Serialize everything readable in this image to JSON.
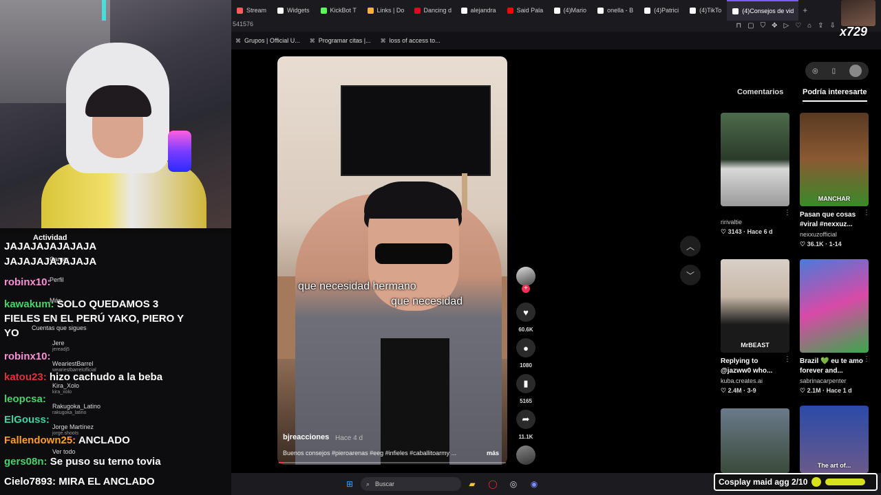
{
  "browser": {
    "tabs": [
      {
        "label": "Stream",
        "color": "#ff5b5b"
      },
      {
        "label": "Widgets",
        "color": "#ffffff"
      },
      {
        "label": "KickBot T",
        "color": "#5bff5b"
      },
      {
        "label": "Links | Do",
        "color": "#ffb13b"
      },
      {
        "label": "Dancing d",
        "color": "#e60023"
      },
      {
        "label": "alejandra",
        "color": "#ffffff"
      },
      {
        "label": "Said Pala",
        "color": "#ff0000"
      },
      {
        "label": "(4)Mario",
        "color": "#ffffff"
      },
      {
        "label": "onella - B",
        "color": "#ffffff"
      },
      {
        "label": "(4)Patrici",
        "color": "#ffffff"
      },
      {
        "label": "(4)TikTo",
        "color": "#ffffff"
      },
      {
        "label": "(4)Consejos de vid",
        "color": "#ffffff"
      }
    ],
    "new_tab": "+",
    "address_fragment": "541576",
    "bookmarks": [
      {
        "label": "Grupos | Official U...",
        "icon": "link-icon"
      },
      {
        "label": "Programar citas |...",
        "icon": "link-icon"
      },
      {
        "label": "loss of access to...",
        "icon": "link-icon"
      }
    ]
  },
  "webcam_overlay": {
    "badge": "x729"
  },
  "chat": {
    "activity_label": "Actividad",
    "menu": [
      {
        "label": "Cargar"
      },
      {
        "label": "Perfil"
      },
      {
        "label": "Más"
      },
      {
        "label": "Cuentas que sigues"
      }
    ],
    "follows": [
      {
        "name": "Jere",
        "handle": "jereadj5"
      },
      {
        "name": "WeariestBarrel",
        "handle": "weariestbarrelofficial"
      },
      {
        "name": "Kira_Xolo",
        "handle": "kira_xolo"
      },
      {
        "name": "Rakugoka_Latino",
        "handle": "rakugoka_latino"
      },
      {
        "name": "Jorge Martínez",
        "handle": "jorge.shoots"
      }
    ],
    "see_all": "Ver todo",
    "messages": [
      {
        "user": "",
        "text": "JAJAJAJAJAJAJA",
        "color": "#ffffff"
      },
      {
        "user": "",
        "text": "JAJAJAJAJAJAJA",
        "color": "#ffffff"
      },
      {
        "user": "robinx10:",
        "text": "",
        "color": "#ff8fd6"
      },
      {
        "user": "kawakum:",
        "text": "SOLO QUEDAMOS 3",
        "color": "#46d36a"
      },
      {
        "user": "",
        "text": "FIELES EN EL PERÚ YAKO, PIERO Y",
        "color": "#ffffff"
      },
      {
        "user": "",
        "text": "YO",
        "color": "#ffffff"
      },
      {
        "user": "robinx10:",
        "text": "",
        "color": "#ff8fd6"
      },
      {
        "user": "katou23:",
        "text": "hizo cachudo a la beba",
        "color": "#e0323a"
      },
      {
        "user": "leopcsa:",
        "text": "",
        "color": "#46d36a"
      },
      {
        "user": "ElGouss:",
        "text": "",
        "color": "#3bd4a5"
      },
      {
        "user": "Fallendown25:",
        "text": "ANCLADO",
        "color": "#ff9f2a"
      },
      {
        "user": "gers08n:",
        "text": "Se puso su terno tovia",
        "color": "#46d36a"
      }
    ],
    "last_message": {
      "user": "Cielo7893:",
      "text": "MIRA EL ANCLADO",
      "color": "#ffffff"
    }
  },
  "video": {
    "captions": [
      "que necesidad hermano",
      "que necesidad"
    ],
    "author": "bjreacciones",
    "time": "Hace 4 d",
    "description": "Buenos consejos #pieroarenas #eeg #infieles #caballitoarmy ...",
    "more": "más",
    "progress": 0.02,
    "rail": {
      "likes": "60.6K",
      "comments": "1080",
      "saves": "5165",
      "shares": "11.1K"
    }
  },
  "right_panel": {
    "tabs": [
      "Comentarios",
      "Podría interesarte"
    ],
    "active_tab": 1,
    "cards": [
      {
        "title": "",
        "author": "ririvaltie",
        "stats": "♡ 3143 · Hace 6 d",
        "thumb_label": "",
        "bg": "linear-gradient(180deg,#4c6b4a,#2a3a2a 50%,#d8d8d8 60%,#9a9a9a)"
      },
      {
        "title": "Pasan que cosas #viral #nexxuz...",
        "author": "nexxuzofficial",
        "stats": "♡ 36.1K · 1-14",
        "thumb_label": "MANCHAR",
        "bg": "linear-gradient(180deg,#5a3a22,#8a5a32 50%,#3a8a2a)"
      },
      {
        "title": "Replying to @jazww0 who...",
        "author": "kuba.creates.ai",
        "stats": "♡ 2.4M · 3-9",
        "thumb_label": "MrBEAST",
        "bg": "linear-gradient(180deg,#d8d0c8,#c8b8a8 40%,#1a1a1a 70%)"
      },
      {
        "title": "Brazil 💚 eu te amo forever and...",
        "author": "sabrinacarpenter",
        "stats": "♡ 2.1M · Hace 1 d",
        "thumb_label": "",
        "bg": "linear-gradient(160deg,#4a7ad8,#d84aa8 50%,#3aa84a)"
      },
      {
        "title": "",
        "author": "",
        "stats": "",
        "thumb_label": "",
        "bg": "linear-gradient(180deg,#6a7a8a,#3a4a3a)"
      },
      {
        "title": "",
        "author": "",
        "stats": "",
        "thumb_label": "The art of...",
        "bg": "linear-gradient(180deg,#2a4aa8,#6a5a8a)"
      }
    ]
  },
  "taskbar": {
    "search_placeholder": "Buscar",
    "goal": "Cosplay maid agg 2/10"
  }
}
